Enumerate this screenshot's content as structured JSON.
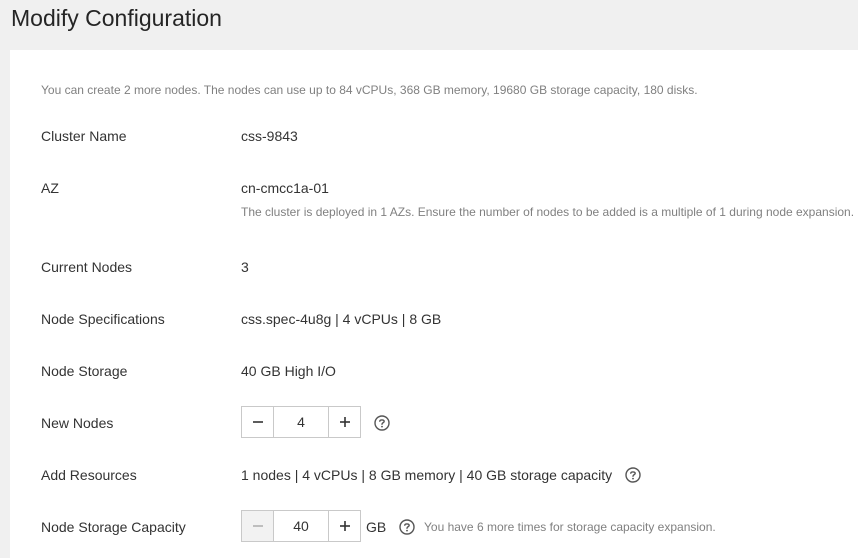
{
  "page": {
    "title": "Modify Configuration"
  },
  "tip": "You can create 2 more nodes. The nodes can use up to 84 vCPUs, 368 GB memory, 19680 GB storage capacity, 180 disks.",
  "cluster_name": {
    "label": "Cluster Name",
    "value": "css-9843"
  },
  "az": {
    "label": "AZ",
    "value": "cn-cmcc1a-01",
    "tip": "The cluster is deployed in 1 AZs. Ensure the number of nodes to be added is a multiple of 1 during node expansion."
  },
  "current_nodes": {
    "label": "Current Nodes",
    "value": "3"
  },
  "node_spec": {
    "label": "Node Specifications",
    "value": "css.spec-4u8g | 4 vCPUs | 8 GB"
  },
  "node_storage": {
    "label": "Node Storage",
    "value": "40 GB High I/O"
  },
  "new_nodes": {
    "label": "New Nodes",
    "value": "4"
  },
  "add_resources": {
    "label": "Add Resources",
    "value": "1 nodes | 4 vCPUs | 8 GB memory | 40 GB storage capacity"
  },
  "storage_capacity": {
    "label": "Node Storage Capacity",
    "value": "40",
    "unit": "GB",
    "tip": "You have 6 more times for storage capacity expansion."
  },
  "icons": {
    "help": "question-circle-icon",
    "minus": "minus-icon",
    "plus": "plus-icon"
  },
  "colors": {
    "muted_text": "#808080",
    "border": "#c9c9c9",
    "disabled_bg": "#f2f2f2"
  }
}
